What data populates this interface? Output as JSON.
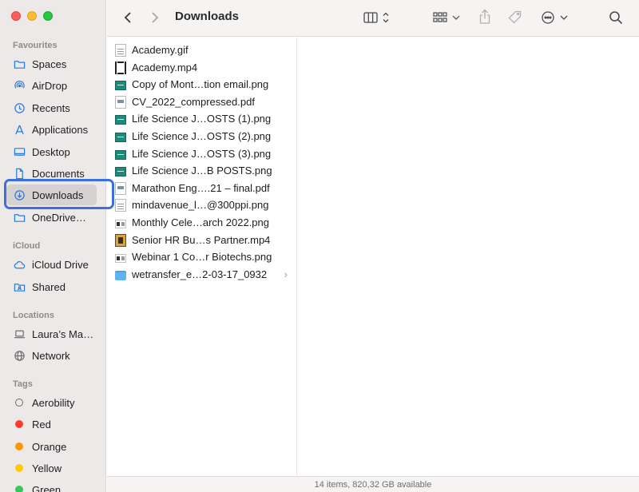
{
  "toolbar": {
    "title": "Downloads"
  },
  "sidebar": {
    "favourites_title": "Favourites",
    "favourites": [
      {
        "label": "Spaces",
        "icon": "folder-icon"
      },
      {
        "label": "AirDrop",
        "icon": "airdrop-icon"
      },
      {
        "label": "Recents",
        "icon": "clock-icon"
      },
      {
        "label": "Applications",
        "icon": "applications-icon"
      },
      {
        "label": "Desktop",
        "icon": "desktop-icon"
      },
      {
        "label": "Documents",
        "icon": "document-icon"
      },
      {
        "label": "Downloads",
        "icon": "download-icon"
      },
      {
        "label": "OneDrive…",
        "icon": "folder-icon"
      }
    ],
    "icloud_title": "iCloud",
    "icloud": [
      {
        "label": "iCloud Drive",
        "icon": "cloud-icon"
      },
      {
        "label": "Shared",
        "icon": "shared-folder-icon"
      }
    ],
    "locations_title": "Locations",
    "locations": [
      {
        "label": "Laura’s Ma…",
        "icon": "laptop-icon"
      },
      {
        "label": "Network",
        "icon": "globe-icon"
      }
    ],
    "tags_title": "Tags",
    "tags": [
      {
        "label": "Aerobility",
        "color": "#8a8a8a"
      },
      {
        "label": "Red",
        "color": "#ff3b30"
      },
      {
        "label": "Orange",
        "color": "#ff9500"
      },
      {
        "label": "Yellow",
        "color": "#ffcc00"
      },
      {
        "label": "Green",
        "color": "#34c759"
      }
    ]
  },
  "files": [
    {
      "name": "Academy.gif",
      "type": "doc"
    },
    {
      "name": "Academy.mp4",
      "type": "video"
    },
    {
      "name": "Copy of Mont…tion email.png",
      "type": "teal"
    },
    {
      "name": "CV_2022_compressed.pdf",
      "type": "pdf"
    },
    {
      "name": "Life Science J…OSTS (1).png",
      "type": "teal"
    },
    {
      "name": "Life Science J…OSTS (2).png",
      "type": "teal"
    },
    {
      "name": "Life Science J…OSTS (3).png",
      "type": "teal"
    },
    {
      "name": "Life Science J…B POSTS.png",
      "type": "teal"
    },
    {
      "name": "Marathon Eng….21 – final.pdf",
      "type": "pdf"
    },
    {
      "name": "mindavenue_l…@300ppi.png",
      "type": "doc"
    },
    {
      "name": "Monthly Cele…arch 2022.png",
      "type": "strip"
    },
    {
      "name": "Senior HR  Bu…s Partner.mp4",
      "type": "film"
    },
    {
      "name": "Webinar 1 Co…r Biotechs.png",
      "type": "strip"
    },
    {
      "name": "wetransfer_e…2-03-17_0932",
      "type": "folder"
    }
  ],
  "status": {
    "text": "14 items, 820,32 GB available"
  }
}
